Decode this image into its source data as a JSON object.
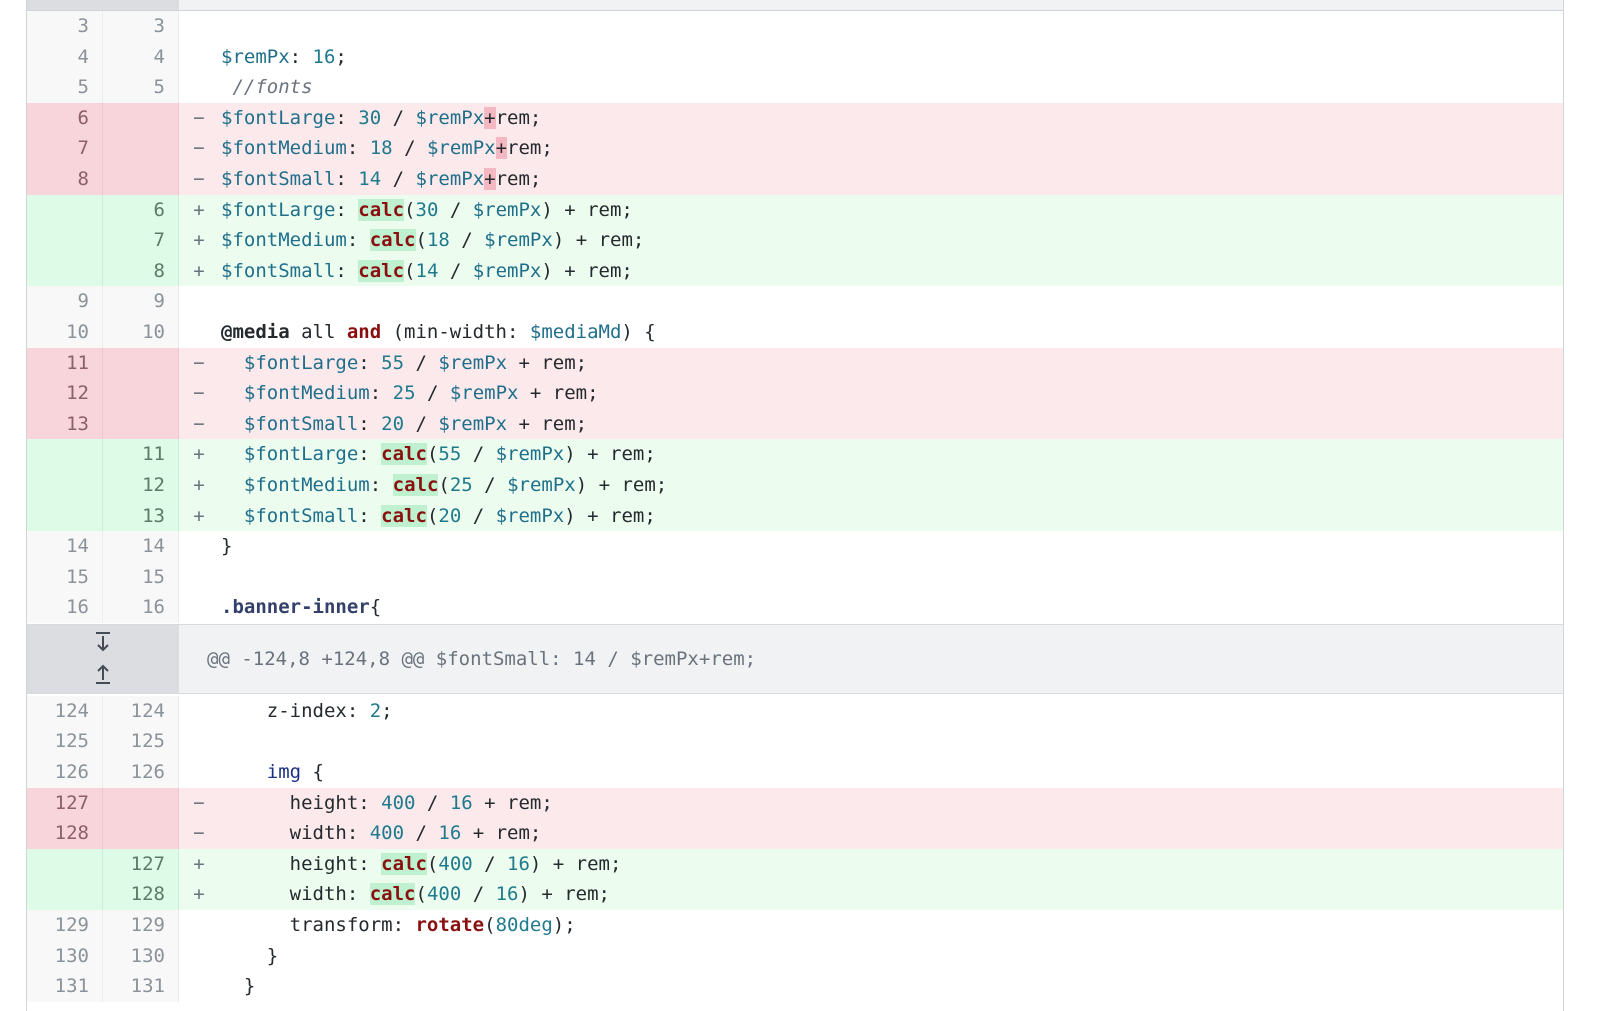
{
  "colors": {
    "deleted_line_bg": "#fbe9eb",
    "added_line_bg": "#ecfdf0",
    "deleted_highlight": "#f3b8c1",
    "added_highlight": "#bff0cf",
    "hunk_header_bg": "#f1f2f3"
  },
  "markers": {
    "del": "−",
    "add": "+"
  },
  "icons": {
    "expand_down": "expand-down-icon",
    "expand_up": "expand-up-icon"
  },
  "section1": [
    {
      "old": "3",
      "new": "3",
      "type": "ctx",
      "code": ""
    },
    {
      "old": "4",
      "new": "4",
      "type": "ctx",
      "code": "$remPx: 16;"
    },
    {
      "old": "5",
      "new": "5",
      "type": "ctx",
      "code": " //fonts"
    },
    {
      "old": "6",
      "new": "",
      "type": "del",
      "code": "$fontLarge: 30 / $remPx+rem;"
    },
    {
      "old": "7",
      "new": "",
      "type": "del",
      "code": "$fontMedium: 18 / $remPx+rem;"
    },
    {
      "old": "8",
      "new": "",
      "type": "del",
      "code": "$fontSmall: 14 / $remPx+rem;"
    },
    {
      "old": "",
      "new": "6",
      "type": "add",
      "code": "$fontLarge: calc(30 / $remPx) + rem;"
    },
    {
      "old": "",
      "new": "7",
      "type": "add",
      "code": "$fontMedium: calc(18 / $remPx) + rem;"
    },
    {
      "old": "",
      "new": "8",
      "type": "add",
      "code": "$fontSmall: calc(14 / $remPx) + rem;"
    },
    {
      "old": "9",
      "new": "9",
      "type": "ctx",
      "code": ""
    },
    {
      "old": "10",
      "new": "10",
      "type": "ctx",
      "code": "@media all and (min-width: $mediaMd) {"
    },
    {
      "old": "11",
      "new": "",
      "type": "del",
      "code": "  $fontLarge: 55 / $remPx + rem;"
    },
    {
      "old": "12",
      "new": "",
      "type": "del",
      "code": "  $fontMedium: 25 / $remPx + rem;"
    },
    {
      "old": "13",
      "new": "",
      "type": "del",
      "code": "  $fontSmall: 20 / $remPx + rem;"
    },
    {
      "old": "",
      "new": "11",
      "type": "add",
      "code": "  $fontLarge: calc(55 / $remPx) + rem;"
    },
    {
      "old": "",
      "new": "12",
      "type": "add",
      "code": "  $fontMedium: calc(25 / $remPx) + rem;"
    },
    {
      "old": "",
      "new": "13",
      "type": "add",
      "code": "  $fontSmall: calc(20 / $remPx) + rem;"
    },
    {
      "old": "14",
      "new": "14",
      "type": "ctx",
      "code": "}"
    },
    {
      "old": "15",
      "new": "15",
      "type": "ctx",
      "code": ""
    },
    {
      "old": "16",
      "new": "16",
      "type": "ctx",
      "code": ".banner-inner{"
    }
  ],
  "hunk": {
    "header": "@@ -124,8 +124,8 @@ $fontSmall: 14 / $remPx+rem;"
  },
  "section2": [
    {
      "old": "124",
      "new": "124",
      "type": "ctx",
      "code": "    z-index: 2;"
    },
    {
      "old": "125",
      "new": "125",
      "type": "ctx",
      "code": ""
    },
    {
      "old": "126",
      "new": "126",
      "type": "ctx",
      "code": "    img {"
    },
    {
      "old": "127",
      "new": "",
      "type": "del",
      "code": "      height: 400 / 16 + rem;"
    },
    {
      "old": "128",
      "new": "",
      "type": "del",
      "code": "      width: 400 / 16 + rem;"
    },
    {
      "old": "",
      "new": "127",
      "type": "add",
      "code": "      height: calc(400 / 16) + rem;"
    },
    {
      "old": "",
      "new": "128",
      "type": "add",
      "code": "      width: calc(400 / 16) + rem;"
    },
    {
      "old": "129",
      "new": "129",
      "type": "ctx",
      "code": "      transform: rotate(80deg);"
    },
    {
      "old": "130",
      "new": "130",
      "type": "ctx",
      "code": "    }"
    },
    {
      "old": "131",
      "new": "131",
      "type": "ctx",
      "code": "  }"
    }
  ]
}
